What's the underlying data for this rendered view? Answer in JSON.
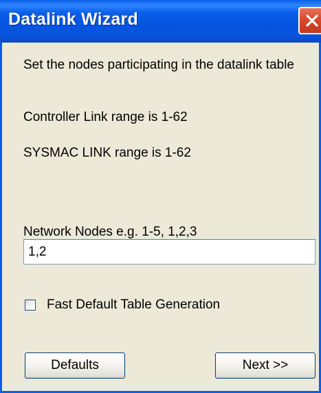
{
  "window": {
    "title": "Datalink Wizard",
    "close_icon": "close-icon"
  },
  "content": {
    "intro": "Set the nodes participating in the datalink table",
    "controller_range": "Controller Link range is 1-62",
    "sysmac_range": "SYSMAC LINK range is 1-62",
    "nodes_label": "Network Nodes  e.g. 1-5, 1,2,3",
    "nodes_value": "1,2",
    "fast_default_label": "Fast Default Table Generation",
    "fast_default_checked": false
  },
  "buttons": {
    "defaults_label": "Defaults",
    "next_label": "Next   >>"
  },
  "colors": {
    "title_bar": "#0a5fe8",
    "close_button": "#d6482a",
    "dialog_background": "#ece9d8"
  }
}
